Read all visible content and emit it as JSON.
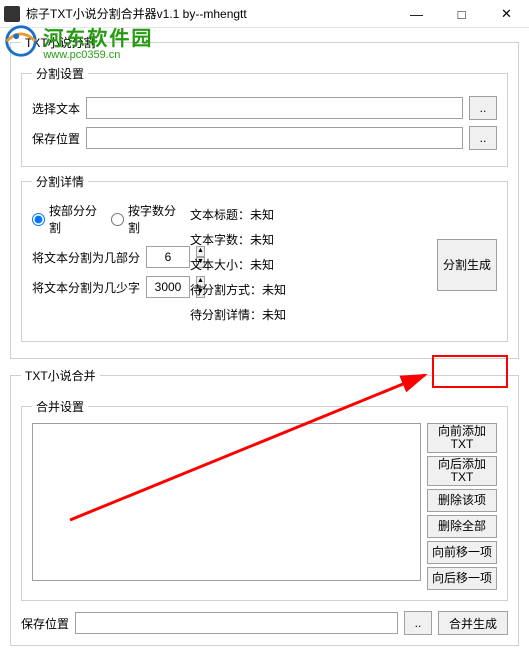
{
  "window": {
    "title": "棕子TXT小说分割合并器v1.1    by--mhengtt",
    "min": "—",
    "max": "□",
    "close": "✕"
  },
  "watermark": {
    "name": "河东软件园",
    "url": "www.pc0359.cn"
  },
  "split": {
    "legend": "TXT小说分割",
    "settings_legend": "分割设置",
    "select_text_label": "选择文本",
    "save_path_label": "保存位置",
    "dots": "..",
    "detail_legend": "分割详情",
    "by_part": "按部分分割",
    "by_count": "按字数分割",
    "parts_label": "将文本分割为几部分",
    "parts_value": "6",
    "count_label": "将文本分割为几少字",
    "count_value": "3000",
    "info_title_label": "文本标题：",
    "info_title_value": "未知",
    "info_words_label": "文本字数：",
    "info_words_value": "未知",
    "info_size_label": "文本大小：",
    "info_size_value": "未知",
    "info_method_label": "待分割方式：",
    "info_method_value": "未知",
    "info_detail_label": "待分割详情：",
    "info_detail_value": "未知",
    "generate": "分割生成"
  },
  "merge": {
    "legend": "TXT小说合并",
    "settings_legend": "合并设置",
    "add_before": "向前添加TXT",
    "add_after": "向后添加TXT",
    "delete_item": "删除该项",
    "delete_all": "删除全部",
    "move_up": "向前移一项",
    "move_down": "向后移一项",
    "save_path_label": "保存位置",
    "dots": "..",
    "generate": "合并生成"
  }
}
